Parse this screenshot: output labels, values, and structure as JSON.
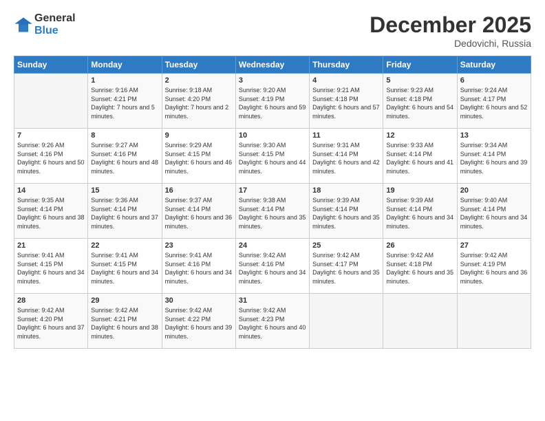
{
  "header": {
    "logo_line1": "General",
    "logo_line2": "Blue",
    "month": "December 2025",
    "location": "Dedovichi, Russia"
  },
  "weekdays": [
    "Sunday",
    "Monday",
    "Tuesday",
    "Wednesday",
    "Thursday",
    "Friday",
    "Saturday"
  ],
  "weeks": [
    [
      {
        "day": "",
        "sunrise": "",
        "sunset": "",
        "daylight": ""
      },
      {
        "day": "1",
        "sunrise": "Sunrise: 9:16 AM",
        "sunset": "Sunset: 4:21 PM",
        "daylight": "Daylight: 7 hours and 5 minutes."
      },
      {
        "day": "2",
        "sunrise": "Sunrise: 9:18 AM",
        "sunset": "Sunset: 4:20 PM",
        "daylight": "Daylight: 7 hours and 2 minutes."
      },
      {
        "day": "3",
        "sunrise": "Sunrise: 9:20 AM",
        "sunset": "Sunset: 4:19 PM",
        "daylight": "Daylight: 6 hours and 59 minutes."
      },
      {
        "day": "4",
        "sunrise": "Sunrise: 9:21 AM",
        "sunset": "Sunset: 4:18 PM",
        "daylight": "Daylight: 6 hours and 57 minutes."
      },
      {
        "day": "5",
        "sunrise": "Sunrise: 9:23 AM",
        "sunset": "Sunset: 4:18 PM",
        "daylight": "Daylight: 6 hours and 54 minutes."
      },
      {
        "day": "6",
        "sunrise": "Sunrise: 9:24 AM",
        "sunset": "Sunset: 4:17 PM",
        "daylight": "Daylight: 6 hours and 52 minutes."
      }
    ],
    [
      {
        "day": "7",
        "sunrise": "Sunrise: 9:26 AM",
        "sunset": "Sunset: 4:16 PM",
        "daylight": "Daylight: 6 hours and 50 minutes."
      },
      {
        "day": "8",
        "sunrise": "Sunrise: 9:27 AM",
        "sunset": "Sunset: 4:16 PM",
        "daylight": "Daylight: 6 hours and 48 minutes."
      },
      {
        "day": "9",
        "sunrise": "Sunrise: 9:29 AM",
        "sunset": "Sunset: 4:15 PM",
        "daylight": "Daylight: 6 hours and 46 minutes."
      },
      {
        "day": "10",
        "sunrise": "Sunrise: 9:30 AM",
        "sunset": "Sunset: 4:15 PM",
        "daylight": "Daylight: 6 hours and 44 minutes."
      },
      {
        "day": "11",
        "sunrise": "Sunrise: 9:31 AM",
        "sunset": "Sunset: 4:14 PM",
        "daylight": "Daylight: 6 hours and 42 minutes."
      },
      {
        "day": "12",
        "sunrise": "Sunrise: 9:33 AM",
        "sunset": "Sunset: 4:14 PM",
        "daylight": "Daylight: 6 hours and 41 minutes."
      },
      {
        "day": "13",
        "sunrise": "Sunrise: 9:34 AM",
        "sunset": "Sunset: 4:14 PM",
        "daylight": "Daylight: 6 hours and 39 minutes."
      }
    ],
    [
      {
        "day": "14",
        "sunrise": "Sunrise: 9:35 AM",
        "sunset": "Sunset: 4:14 PM",
        "daylight": "Daylight: 6 hours and 38 minutes."
      },
      {
        "day": "15",
        "sunrise": "Sunrise: 9:36 AM",
        "sunset": "Sunset: 4:14 PM",
        "daylight": "Daylight: 6 hours and 37 minutes."
      },
      {
        "day": "16",
        "sunrise": "Sunrise: 9:37 AM",
        "sunset": "Sunset: 4:14 PM",
        "daylight": "Daylight: 6 hours and 36 minutes."
      },
      {
        "day": "17",
        "sunrise": "Sunrise: 9:38 AM",
        "sunset": "Sunset: 4:14 PM",
        "daylight": "Daylight: 6 hours and 35 minutes."
      },
      {
        "day": "18",
        "sunrise": "Sunrise: 9:39 AM",
        "sunset": "Sunset: 4:14 PM",
        "daylight": "Daylight: 6 hours and 35 minutes."
      },
      {
        "day": "19",
        "sunrise": "Sunrise: 9:39 AM",
        "sunset": "Sunset: 4:14 PM",
        "daylight": "Daylight: 6 hours and 34 minutes."
      },
      {
        "day": "20",
        "sunrise": "Sunrise: 9:40 AM",
        "sunset": "Sunset: 4:14 PM",
        "daylight": "Daylight: 6 hours and 34 minutes."
      }
    ],
    [
      {
        "day": "21",
        "sunrise": "Sunrise: 9:41 AM",
        "sunset": "Sunset: 4:15 PM",
        "daylight": "Daylight: 6 hours and 34 minutes."
      },
      {
        "day": "22",
        "sunrise": "Sunrise: 9:41 AM",
        "sunset": "Sunset: 4:15 PM",
        "daylight": "Daylight: 6 hours and 34 minutes."
      },
      {
        "day": "23",
        "sunrise": "Sunrise: 9:41 AM",
        "sunset": "Sunset: 4:16 PM",
        "daylight": "Daylight: 6 hours and 34 minutes."
      },
      {
        "day": "24",
        "sunrise": "Sunrise: 9:42 AM",
        "sunset": "Sunset: 4:16 PM",
        "daylight": "Daylight: 6 hours and 34 minutes."
      },
      {
        "day": "25",
        "sunrise": "Sunrise: 9:42 AM",
        "sunset": "Sunset: 4:17 PM",
        "daylight": "Daylight: 6 hours and 35 minutes."
      },
      {
        "day": "26",
        "sunrise": "Sunrise: 9:42 AM",
        "sunset": "Sunset: 4:18 PM",
        "daylight": "Daylight: 6 hours and 35 minutes."
      },
      {
        "day": "27",
        "sunrise": "Sunrise: 9:42 AM",
        "sunset": "Sunset: 4:19 PM",
        "daylight": "Daylight: 6 hours and 36 minutes."
      }
    ],
    [
      {
        "day": "28",
        "sunrise": "Sunrise: 9:42 AM",
        "sunset": "Sunset: 4:20 PM",
        "daylight": "Daylight: 6 hours and 37 minutes."
      },
      {
        "day": "29",
        "sunrise": "Sunrise: 9:42 AM",
        "sunset": "Sunset: 4:21 PM",
        "daylight": "Daylight: 6 hours and 38 minutes."
      },
      {
        "day": "30",
        "sunrise": "Sunrise: 9:42 AM",
        "sunset": "Sunset: 4:22 PM",
        "daylight": "Daylight: 6 hours and 39 minutes."
      },
      {
        "day": "31",
        "sunrise": "Sunrise: 9:42 AM",
        "sunset": "Sunset: 4:23 PM",
        "daylight": "Daylight: 6 hours and 40 minutes."
      },
      {
        "day": "",
        "sunrise": "",
        "sunset": "",
        "daylight": ""
      },
      {
        "day": "",
        "sunrise": "",
        "sunset": "",
        "daylight": ""
      },
      {
        "day": "",
        "sunrise": "",
        "sunset": "",
        "daylight": ""
      }
    ]
  ]
}
